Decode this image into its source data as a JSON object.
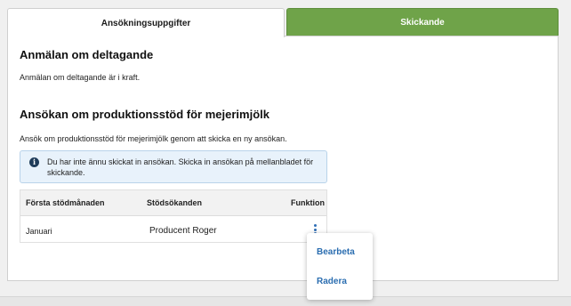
{
  "tabs": [
    {
      "label": "Ansökningsuppgifter"
    },
    {
      "label": "Skickande"
    }
  ],
  "participation": {
    "heading": "Anmälan om deltagande",
    "text": "Anmälan om deltagande är i kraft."
  },
  "application": {
    "heading": "Ansökan om produktionsstöd för mejerimjölk",
    "text": "Ansök om produktionsstöd för mejerimjölk genom att skicka en ny ansökan."
  },
  "notice": {
    "icon": "info-icon",
    "text": "Du har inte ännu skickat in ansökan. Skicka in ansökan på mellanbladet för skickande."
  },
  "table": {
    "headers": [
      "Första stödmånaden",
      "Stödsökanden",
      "Funktion"
    ],
    "rows": [
      {
        "month": "Januari",
        "applicant": "Producent Roger"
      }
    ]
  },
  "menu": {
    "items": [
      {
        "label": "Bearbeta"
      },
      {
        "label": "Radera"
      }
    ]
  },
  "colors": {
    "accent_green": "#6fa349",
    "link_blue": "#2a6db0",
    "info_bg": "#e8f2fb"
  }
}
